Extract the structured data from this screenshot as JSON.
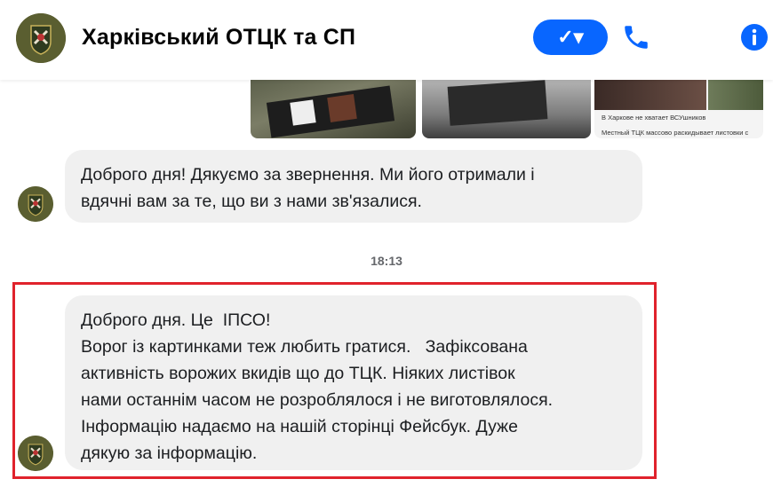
{
  "header": {
    "title": "Харківський ОТЦК та СП",
    "check_label": "✓▾"
  },
  "images": {
    "third_caption_1": "В Харкове не хватает ВСУшников",
    "third_caption_2": "Местный ТЦК массово раскидывает листовки с"
  },
  "messages": [
    {
      "lines": [
        "Доброго дня! Дякуємо за звернення. Ми його отримали і",
        "вдячні вам за те, що ви з нами зв'язалися."
      ]
    },
    {
      "lines": [
        "Доброго дня. Це  ІПСО!",
        "Ворог із картинками теж любить гратися.   Зафіксована",
        "активність ворожих вкидів що до ТЦК. Ніяких листівок",
        "нами останнім часом не розроблялося і не виготовлялося.",
        "Інформацію надаємо на нашій сторінці Фейсбук. Дуже",
        "дякую за інформацію."
      ]
    }
  ],
  "timestamp": "18:13",
  "colors": {
    "accent": "#0866ff",
    "bubble": "#f0f0f0",
    "highlight": "#e0222c"
  }
}
